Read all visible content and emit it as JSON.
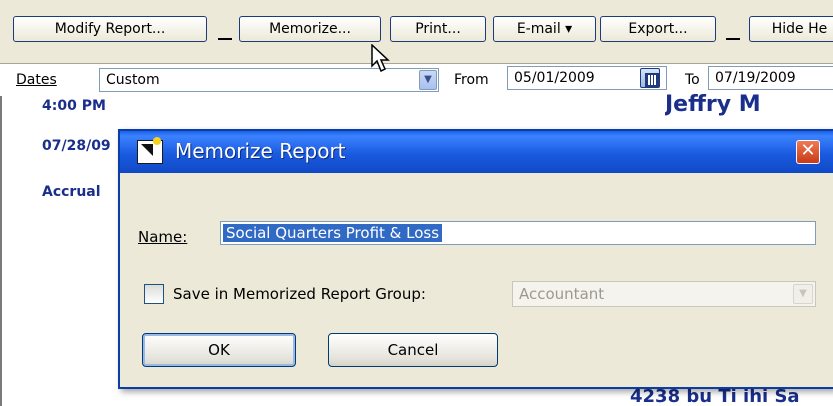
{
  "toolbar": {
    "modify_report": "Modify Report...",
    "memorize": "Memorize...",
    "print": "Print...",
    "email": "E-mail ▾",
    "export": "Export...",
    "hide_header": "Hide He"
  },
  "dates_bar": {
    "dates_label": "Dates",
    "dates_value": "Custom",
    "from_label": "From",
    "from_value": "05/01/2009",
    "to_label": "To",
    "to_value": "07/19/2009"
  },
  "report": {
    "time": "4:00 PM",
    "date": "07/28/09",
    "basis": "Accrual",
    "title_fragment": "Jeffry      M",
    "footer_fragment": "4238 bu Ti ihi  Sa"
  },
  "dialog": {
    "title": "Memorize Report",
    "close_glyph": "✕",
    "name_label": "Name:",
    "name_value": "Social Quarters Profit & Loss",
    "save_group_label": "Save in Memorized Report Group:",
    "save_group_checked": false,
    "group_value": "Accountant",
    "ok_label": "OK",
    "cancel_label": "Cancel"
  },
  "colors": {
    "titlebar": "#1a5ae0",
    "selection": "#316ac5",
    "report_text": "#1a2e8c",
    "close_button": "#c83a18"
  }
}
